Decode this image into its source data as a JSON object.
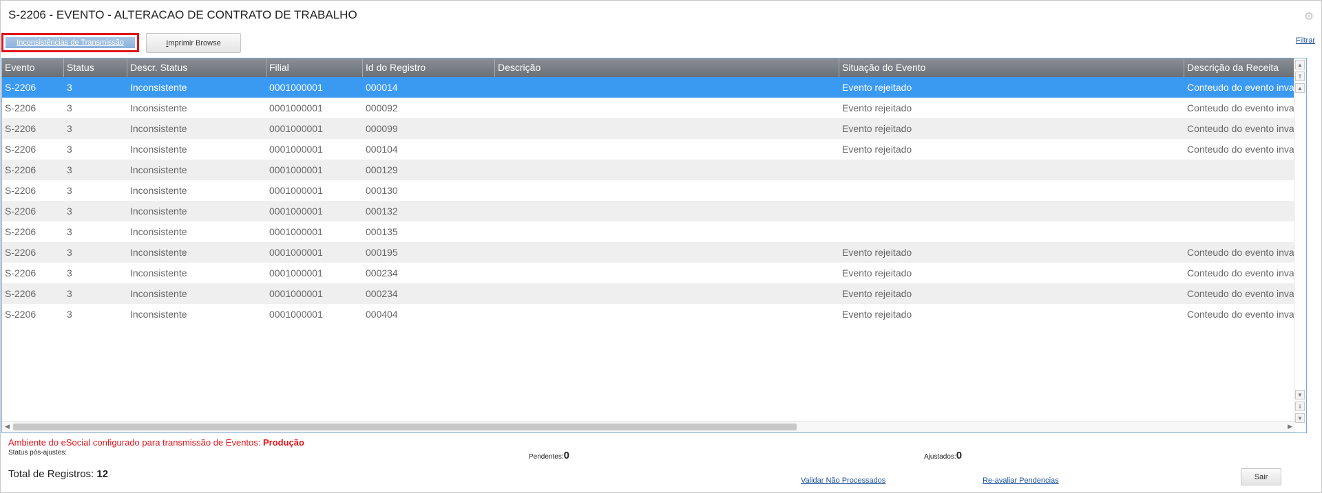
{
  "page": {
    "title": "S-2206 - EVENTO - ALTERACAO DE CONTRATO DE TRABALHO",
    "settings_icon": "gear-icon"
  },
  "toolbar": {
    "inconsistencias_label": "Inconsistências de Transmissão",
    "imprimir_prefix": "I",
    "imprimir_rest": "mprimir Browse",
    "filtrar_label": "Filtrar"
  },
  "grid": {
    "columns": [
      "Evento",
      "Status",
      "Descr. Status",
      "Filial",
      "Id do Registro",
      "Descrição",
      "Situação do Evento",
      "Descrição da Receita"
    ],
    "rows": [
      [
        "S-2206",
        "3",
        "Inconsistente",
        "0001000001",
        "000014",
        "",
        "Evento rejeitado",
        "Conteudo do evento invalido"
      ],
      [
        "S-2206",
        "3",
        "Inconsistente",
        "0001000001",
        "000092",
        "",
        "Evento rejeitado",
        "Conteudo do evento invalido"
      ],
      [
        "S-2206",
        "3",
        "Inconsistente",
        "0001000001",
        "000099",
        "",
        "Evento rejeitado",
        "Conteudo do evento invalido"
      ],
      [
        "S-2206",
        "3",
        "Inconsistente",
        "0001000001",
        "000104",
        "",
        "Evento rejeitado",
        "Conteudo do evento invalido"
      ],
      [
        "S-2206",
        "3",
        "Inconsistente",
        "0001000001",
        "000129",
        "",
        "",
        ""
      ],
      [
        "S-2206",
        "3",
        "Inconsistente",
        "0001000001",
        "000130",
        "",
        "",
        ""
      ],
      [
        "S-2206",
        "3",
        "Inconsistente",
        "0001000001",
        "000132",
        "",
        "",
        ""
      ],
      [
        "S-2206",
        "3",
        "Inconsistente",
        "0001000001",
        "000135",
        "",
        "",
        ""
      ],
      [
        "S-2206",
        "3",
        "Inconsistente",
        "0001000001",
        "000195",
        "",
        "Evento rejeitado",
        "Conteudo do evento invalido"
      ],
      [
        "S-2206",
        "3",
        "Inconsistente",
        "0001000001",
        "000234",
        "",
        "Evento rejeitado",
        "Conteudo do evento invalido"
      ],
      [
        "S-2206",
        "3",
        "Inconsistente",
        "0001000001",
        "000234",
        "",
        "Evento rejeitado",
        "Conteudo do evento invalido"
      ],
      [
        "S-2206",
        "3",
        "Inconsistente",
        "0001000001",
        "000404",
        "",
        "Evento rejeitado",
        "Conteudo do evento invalido"
      ]
    ],
    "selected_row": 0
  },
  "footer": {
    "env_text": "Ambiente do eSocial configurado para transmissão de Eventos: ",
    "env_value": "Produção",
    "status_pos": "Status pós-ajustes:",
    "pendentes_label": "Pendentes:",
    "pendentes_value": "0",
    "ajustados_label": "Ajustados:",
    "ajustados_value": "0",
    "total_label": "Total de Registros: ",
    "total_value": "12",
    "validar_label": "Validar Não Processados",
    "reavaliar_label": "Re-avaliar Pendencias",
    "sair_label": "Sair"
  },
  "colors": {
    "header_bg": "#7a7f86",
    "selected_row": "#3a9af2",
    "alert_red": "#e0151c",
    "link_blue": "#1b4f9c"
  }
}
